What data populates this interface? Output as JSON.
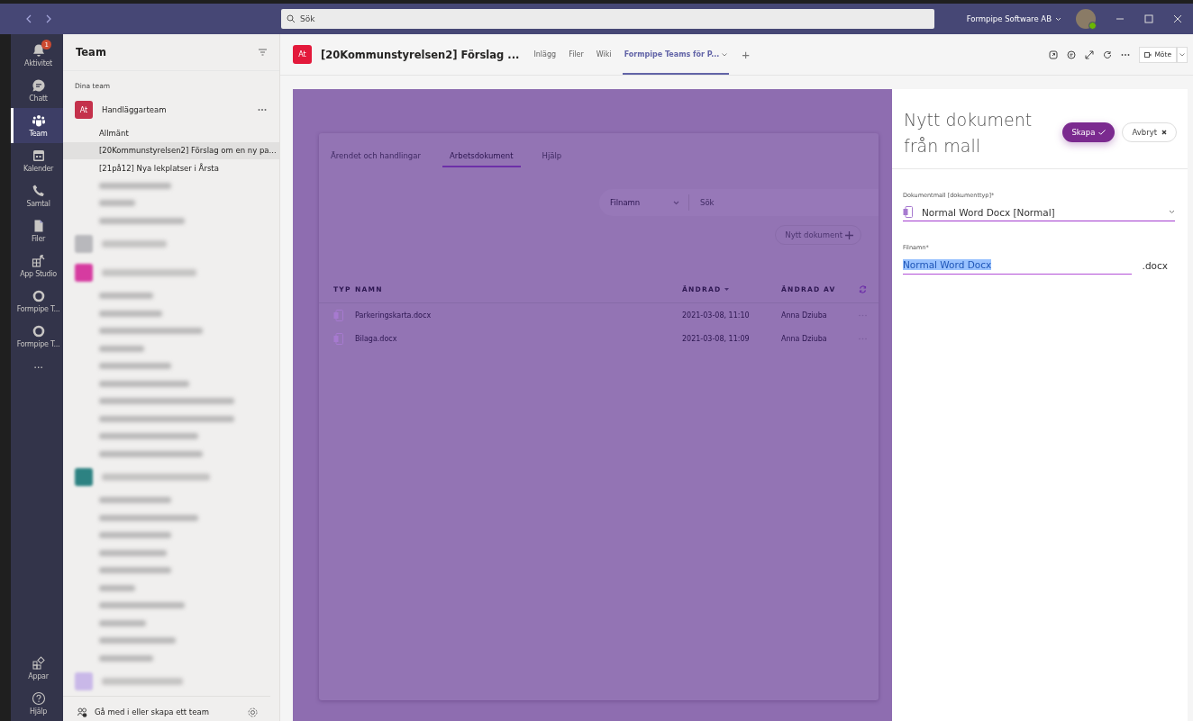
{
  "title_bar": {
    "search_placeholder": "Sök",
    "org": "Formpipe Software AB"
  },
  "rail": {
    "items": [
      {
        "label": "Aktivitet",
        "badge": "1",
        "selected": false
      },
      {
        "label": "Chatt",
        "selected": false
      },
      {
        "label": "Team",
        "selected": true
      },
      {
        "label": "Kalender",
        "selected": false
      },
      {
        "label": "Samtal",
        "selected": false
      },
      {
        "label": "Filer",
        "selected": false
      },
      {
        "label": "App Studio",
        "selected": false
      },
      {
        "label": "Formpipe T...",
        "selected": false
      },
      {
        "label": "Formpipe T...",
        "selected": false
      },
      {
        "label": "...",
        "selected": false
      }
    ],
    "bottom": [
      {
        "label": "Appar"
      },
      {
        "label": "Hjälp"
      }
    ]
  },
  "team_panel": {
    "title": "Team",
    "section": "Dina team",
    "teams": [
      {
        "kind": "named",
        "avatar": "At",
        "name": "Handläggarteam",
        "color": "#c4314b",
        "channels": [
          {
            "kind": "named",
            "name": "Allmänt",
            "selected": false
          },
          {
            "kind": "named",
            "name": "[20Kommunstyrelsen2] Förslag om en ny pa...",
            "selected": true
          },
          {
            "kind": "named",
            "name": "[21på12] Nya lekplatser i Årsta",
            "selected": false
          },
          {
            "kind": "blurred"
          },
          {
            "kind": "blurred"
          },
          {
            "kind": "blurred"
          }
        ]
      },
      {
        "kind": "blurred",
        "color": "#b8b8bc"
      },
      {
        "kind": "blurred",
        "color": "#d63ba0",
        "channels": [
          {
            "kind": "blurred"
          },
          {
            "kind": "blurred"
          },
          {
            "kind": "blurred"
          },
          {
            "kind": "blurred"
          },
          {
            "kind": "blurred"
          },
          {
            "kind": "blurred"
          },
          {
            "kind": "blurred"
          },
          {
            "kind": "blurred"
          },
          {
            "kind": "blurred"
          },
          {
            "kind": "blurred"
          }
        ]
      },
      {
        "kind": "blurred",
        "color": "#2d8282",
        "channels": [
          {
            "kind": "blurred"
          },
          {
            "kind": "blurred"
          },
          {
            "kind": "blurred"
          },
          {
            "kind": "blurred"
          },
          {
            "kind": "blurred"
          },
          {
            "kind": "blurred"
          },
          {
            "kind": "blurred"
          },
          {
            "kind": "blurred"
          },
          {
            "kind": "blurred"
          },
          {
            "kind": "blurred"
          }
        ]
      },
      {
        "kind": "blurred",
        "color": "#c9b8e8"
      }
    ],
    "footer": "Gå med i eller skapa ett team"
  },
  "channel_header": {
    "avatar": "At",
    "title": "[20Kommunstyrelsen2] Förslag ...",
    "tabs": [
      {
        "label": "Inlägg",
        "selected": false
      },
      {
        "label": "Filer",
        "selected": false
      },
      {
        "label": "Wiki",
        "selected": false
      },
      {
        "label": "Formpipe Teams för P...",
        "selected": true
      }
    ],
    "add": "+",
    "meeting": "Möte"
  },
  "document_app": {
    "tabs": [
      {
        "label": "Ärendet och handlingar",
        "selected": false
      },
      {
        "label": "Arbetsdokument",
        "selected": true
      },
      {
        "label": "Hjälp",
        "selected": false
      }
    ],
    "filter": "Filnamn",
    "search_placeholder": "Sök",
    "new_button": "Nytt dokument",
    "table": {
      "columns": [
        "TYP",
        "NAMN",
        "ÄNDRAD",
        "ÄNDRAD AV"
      ],
      "rows": [
        {
          "name": "Parkeringskarta.docx",
          "changed": "2021-03-08, 11:10",
          "changed_by": "Anna Dziuba"
        },
        {
          "name": "Bilaga.docx",
          "changed": "2021-03-08, 11:09",
          "changed_by": "Anna Dziuba"
        }
      ]
    }
  },
  "new_document_panel": {
    "title": "Nytt dokument från mall",
    "create": "Skapa",
    "cancel": "Avbryt",
    "template_label": "Dokumentmall [dokumenttyp]*",
    "template_value": "Normal Word Docx [Normal]",
    "filename_label": "Filnamn*",
    "filename_value": "Normal Word Docx",
    "extension": ".docx"
  }
}
